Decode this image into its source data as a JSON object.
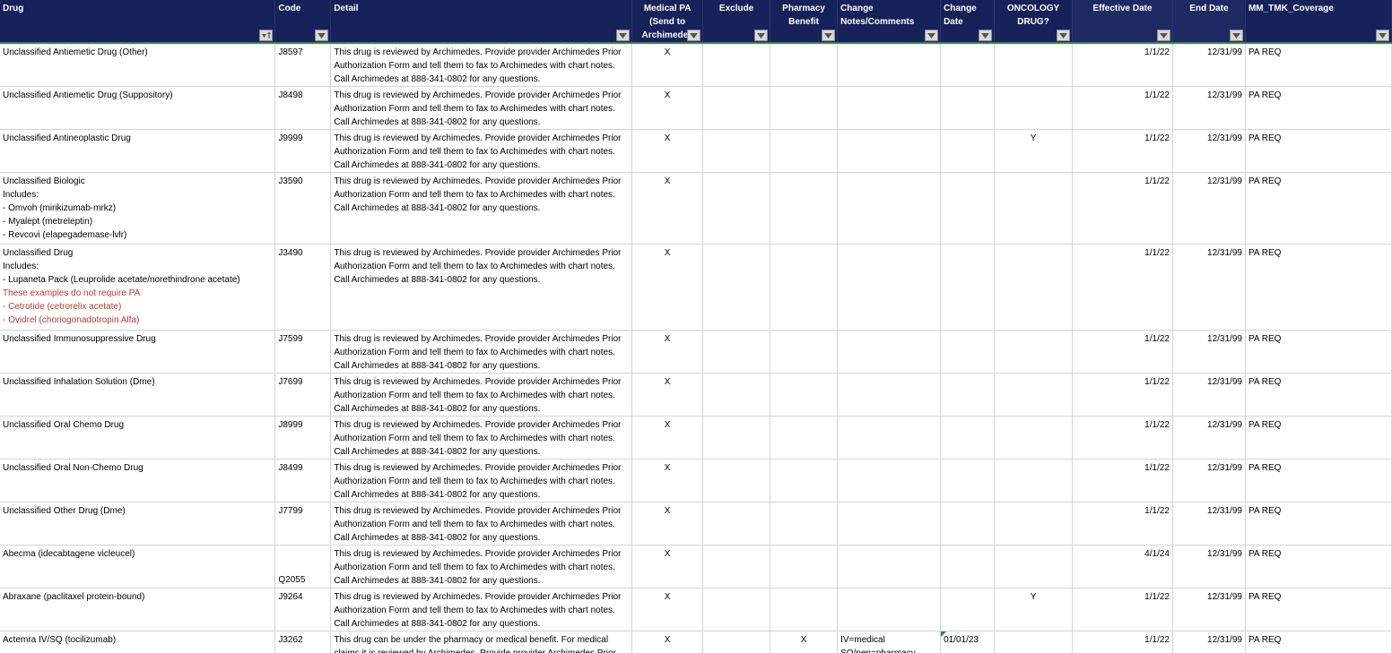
{
  "columns": [
    {
      "key": "drug",
      "label": "Drug"
    },
    {
      "key": "code",
      "label": "Code"
    },
    {
      "key": "detail",
      "label": "Detail"
    },
    {
      "key": "medpa",
      "label": "Medical PA\n(Send to\nArchimedes"
    },
    {
      "key": "exclude",
      "label": "Exclude"
    },
    {
      "key": "pharmacy",
      "label": "Pharmacy\nBenefit"
    },
    {
      "key": "notes",
      "label": "Change\nNotes/Comments"
    },
    {
      "key": "changedate",
      "label": "Change\nDate"
    },
    {
      "key": "oncology",
      "label": "ONCOLOGY\nDRUG?"
    },
    {
      "key": "effective",
      "label": "Effective Date"
    },
    {
      "key": "end",
      "label": "End Date"
    },
    {
      "key": "coverage",
      "label": "MM_TMK_Coverage"
    }
  ],
  "detail_default": "This drug is reviewed by Archimedes. Provide provider Archimedes Prior Authorization Form and tell them to fax to Archimedes with chart notes. Call Archimedes at 888-341-0802 for any questions.",
  "rows": [
    {
      "drug": "Unclassified Antiemetic Drug (Other)",
      "code": "J8597",
      "detail": "This drug is reviewed by Archimedes. Provide provider Archimedes Prior Authorization Form and tell them to fax to Archimedes with chart notes. Call Archimedes at 888-341-0802 for any questions.",
      "medpa": "X",
      "exclude": "",
      "pharmacy": "",
      "notes": "",
      "changedate": "",
      "oncology": "",
      "effective": "1/1/22",
      "end": "12/31/99",
      "coverage": "PA REQ"
    },
    {
      "drug": "Unclassified Antiemetic Drug (Suppository)",
      "code": "J8498",
      "detail": "This drug is reviewed by Archimedes. Provide provider Archimedes Prior Authorization Form and tell them to fax to Archimedes with chart notes. Call Archimedes at 888-341-0802 for any questions.",
      "medpa": "X",
      "exclude": "",
      "pharmacy": "",
      "notes": "",
      "changedate": "",
      "oncology": "",
      "effective": "1/1/22",
      "end": "12/31/99",
      "coverage": "PA REQ"
    },
    {
      "drug": "Unclassified Antineoplastic Drug",
      "code": "J9999",
      "detail": "This drug is reviewed by Archimedes. Provide provider Archimedes Prior Authorization Form and tell them to fax to Archimedes with chart notes. Call Archimedes at 888-341-0802 for any questions.",
      "medpa": "X",
      "exclude": "",
      "pharmacy": "",
      "notes": "",
      "changedate": "",
      "oncology": "Y",
      "effective": "1/1/22",
      "end": "12/31/99",
      "coverage": "PA REQ"
    },
    {
      "drug": "Unclassified Biologic\nIncludes:\n- Omvoh (mirikizumab-mrkz)\n - Myalept (metreleptin)\n - Revcovi (elapegademase-lvlr)",
      "code": "J3590",
      "detail": "This drug is reviewed by Archimedes. Provide provider Archimedes Prior Authorization Form and tell them to fax to Archimedes with chart notes. Call Archimedes at 888-341-0802 for any questions.",
      "medpa": "X",
      "exclude": "",
      "pharmacy": "",
      "notes": "",
      "changedate": "",
      "oncology": "",
      "effective": "1/1/22",
      "end": "12/31/99",
      "coverage": "PA REQ"
    },
    {
      "drug": "Unclassified Drug\nIncludes:\n - Lupaneta Pack (Leuprolide acetate/norethindrone acetate)",
      "drug_red": "These examples do not require PA\n - Cetrotide (cetrorelix acetate)\n - Ovidrel (choriogonadotropin Alfa)",
      "code": "J3490",
      "detail": "This drug is reviewed by Archimedes. Provide provider Archimedes Prior Authorization Form and tell them to fax to Archimedes with chart notes. Call Archimedes at 888-341-0802 for any questions.",
      "medpa": "X",
      "exclude": "",
      "pharmacy": "",
      "notes": "",
      "changedate": "",
      "oncology": "",
      "effective": "1/1/22",
      "end": "12/31/99",
      "coverage": "PA REQ"
    },
    {
      "drug": "Unclassified Immunosuppressive Drug",
      "code": "J7599",
      "detail": "This drug is reviewed by Archimedes. Provide provider Archimedes Prior Authorization Form and tell them to fax to Archimedes with chart notes. Call Archimedes at 888-341-0802 for any questions.",
      "medpa": "X",
      "exclude": "",
      "pharmacy": "",
      "notes": "",
      "changedate": "",
      "oncology": "",
      "effective": "1/1/22",
      "end": "12/31/99",
      "coverage": "PA REQ"
    },
    {
      "drug": "Unclassified Inhalation Solution (Dme)",
      "code": "J7699",
      "detail": "This drug is reviewed by Archimedes. Provide provider Archimedes Prior Authorization Form and tell them to fax to Archimedes with chart notes. Call Archimedes at 888-341-0802 for any questions.",
      "medpa": "X",
      "exclude": "",
      "pharmacy": "",
      "notes": "",
      "changedate": "",
      "oncology": "",
      "effective": "1/1/22",
      "end": "12/31/99",
      "coverage": "PA REQ"
    },
    {
      "drug": "Unclassified Oral Chemo Drug",
      "code": "J8999",
      "detail": "This drug is reviewed by Archimedes. Provide provider Archimedes Prior Authorization Form and tell them to fax to Archimedes with chart notes. Call Archimedes at 888-341-0802 for any questions.",
      "medpa": "X",
      "exclude": "",
      "pharmacy": "",
      "notes": "",
      "changedate": "",
      "oncology": "",
      "effective": "1/1/22",
      "end": "12/31/99",
      "coverage": "PA REQ"
    },
    {
      "drug": "Unclassified Oral Non-Chemo Drug",
      "code": "J8499",
      "detail": "This drug is reviewed by Archimedes. Provide provider Archimedes Prior Authorization Form and tell them to fax to Archimedes with chart notes. Call Archimedes at 888-341-0802 for any questions.",
      "medpa": "X",
      "exclude": "",
      "pharmacy": "",
      "notes": "",
      "changedate": "",
      "oncology": "",
      "effective": "1/1/22",
      "end": "12/31/99",
      "coverage": "PA REQ"
    },
    {
      "drug": "Unclassified Other Drug (Dme)",
      "code": "J7799",
      "detail": "This drug is reviewed by Archimedes. Provide provider Archimedes Prior Authorization Form and tell them to fax to Archimedes with chart notes. Call Archimedes at 888-341-0802 for any questions.",
      "medpa": "X",
      "exclude": "",
      "pharmacy": "",
      "notes": "",
      "changedate": "",
      "oncology": "",
      "effective": "1/1/22",
      "end": "12/31/99",
      "coverage": "PA REQ"
    },
    {
      "drug": "Abecma (idecabtagene vicleucel)",
      "code": "Q2055",
      "code_bottom": true,
      "detail": "This drug is reviewed by Archimedes. Provide provider Archimedes Prior Authorization Form and tell them to fax to Archimedes with chart notes. Call Archimedes at 888-341-0802 for any questions.",
      "medpa": "X",
      "exclude": "",
      "pharmacy": "",
      "notes": "",
      "changedate": "",
      "oncology": "",
      "effective": "4/1/24",
      "end": "12/31/99",
      "coverage": "PA REQ"
    },
    {
      "drug": "Abraxane (paclitaxel protein-bound)",
      "code": "J9264",
      "detail": "This drug is reviewed by Archimedes. Provide provider Archimedes Prior Authorization Form and tell them to fax to Archimedes with chart notes. Call Archimedes at 888-341-0802 for any questions.",
      "medpa": "X",
      "exclude": "",
      "pharmacy": "",
      "notes": "",
      "changedate": "",
      "oncology": "Y",
      "effective": "1/1/22",
      "end": "12/31/99",
      "coverage": "PA REQ"
    },
    {
      "drug": "Actemra  IV/SQ (tocilizumab)",
      "code": "J3262",
      "detail": "This drug can be under the pharmacy or medical benefit.  For medical claims it is reviewed by Archimedes. Provide provider Archimedes Prior",
      "medpa": "X",
      "exclude": "",
      "pharmacy": "X",
      "notes": "IV=medical\nSQ/pen=pharmacy",
      "changedate": "01/01/23",
      "changedate_flag": true,
      "oncology": "",
      "effective": "1/1/22",
      "end": "12/31/99",
      "coverage": "PA REQ"
    }
  ]
}
